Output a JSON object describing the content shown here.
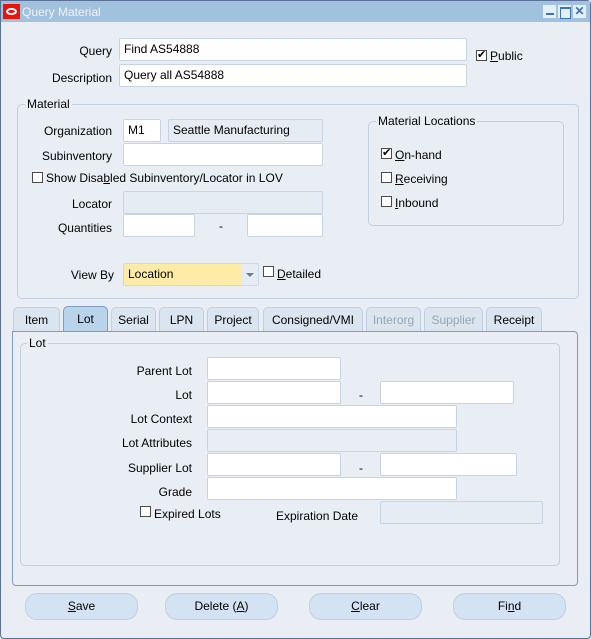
{
  "window": {
    "title": "Query Material",
    "icon": "oracle-icon",
    "controls": [
      "minimize-icon",
      "maximize-icon",
      "close-icon"
    ],
    "close_glyph": "✕"
  },
  "header": {
    "query_label": "Query",
    "query_value": "Find AS54888",
    "description_label": "Description",
    "description_value": "Query all AS54888",
    "public_label_u": "P",
    "public_label_rest": "ublic",
    "public_checked": true
  },
  "material": {
    "group_title": "Material",
    "organization_label": "Organization",
    "organization_code": "M1",
    "organization_name": "Seattle Manufacturing",
    "subinventory_label": "Subinventory",
    "subinventory_value": "",
    "show_disabled_pre": "Show Disa",
    "show_disabled_u": "b",
    "show_disabled_post": "led Subinventory/Locator in LOV",
    "show_disabled_checked": false,
    "locator_label": "Locator",
    "locator_value": "",
    "quantities_label": "Quantities",
    "quantities_from": "",
    "quantities_to": "",
    "range_dash": "-",
    "view_by_label": "View By",
    "view_by_value": "Location",
    "detailed_u": "D",
    "detailed_rest": "etailed",
    "detailed_checked": false
  },
  "material_locations": {
    "group_title": "Material Locations",
    "items": [
      {
        "u": "O",
        "rest": "n-hand",
        "checked": true
      },
      {
        "u": "R",
        "rest": "eceiving",
        "checked": false
      },
      {
        "u": "I",
        "rest": "nbound",
        "checked": false
      }
    ]
  },
  "tabs": [
    {
      "label": "Item",
      "active": false,
      "enabled": true
    },
    {
      "label": "Lot",
      "active": true,
      "enabled": true
    },
    {
      "label": "Serial",
      "active": false,
      "enabled": true
    },
    {
      "label": "LPN",
      "active": false,
      "enabled": true
    },
    {
      "label": "Project",
      "active": false,
      "enabled": true
    },
    {
      "label": "Consigned/VMI",
      "active": false,
      "enabled": true
    },
    {
      "label": "Interorg",
      "active": false,
      "enabled": false
    },
    {
      "label": "Supplier",
      "active": false,
      "enabled": false
    },
    {
      "label": "Receipt",
      "active": false,
      "enabled": true
    }
  ],
  "lot": {
    "group_title": "Lot",
    "parent_lot_label": "Parent Lot",
    "parent_lot_value": "",
    "lot_label": "Lot",
    "lot_from": "",
    "lot_to": "",
    "lot_context_label": "Lot Context",
    "lot_context_value": "",
    "lot_attributes_label": "Lot Attributes",
    "lot_attributes_value": "",
    "supplier_lot_label": "Supplier Lot",
    "supplier_lot_from": "",
    "supplier_lot_to": "",
    "grade_label": "Grade",
    "grade_value": "",
    "expired_lots_label": "Expired Lots",
    "expired_lots_checked": false,
    "expiration_date_label": "Expiration Date",
    "expiration_date_value": "",
    "range_dash": "-"
  },
  "buttons": {
    "save_u": "S",
    "save_rest": "ave",
    "delete_pre": "Delete (",
    "delete_u": "A",
    "delete_post": ")",
    "clear_u": "C",
    "clear_rest": "lear",
    "find_pre": "Fi",
    "find_u": "n",
    "find_post": "d"
  }
}
